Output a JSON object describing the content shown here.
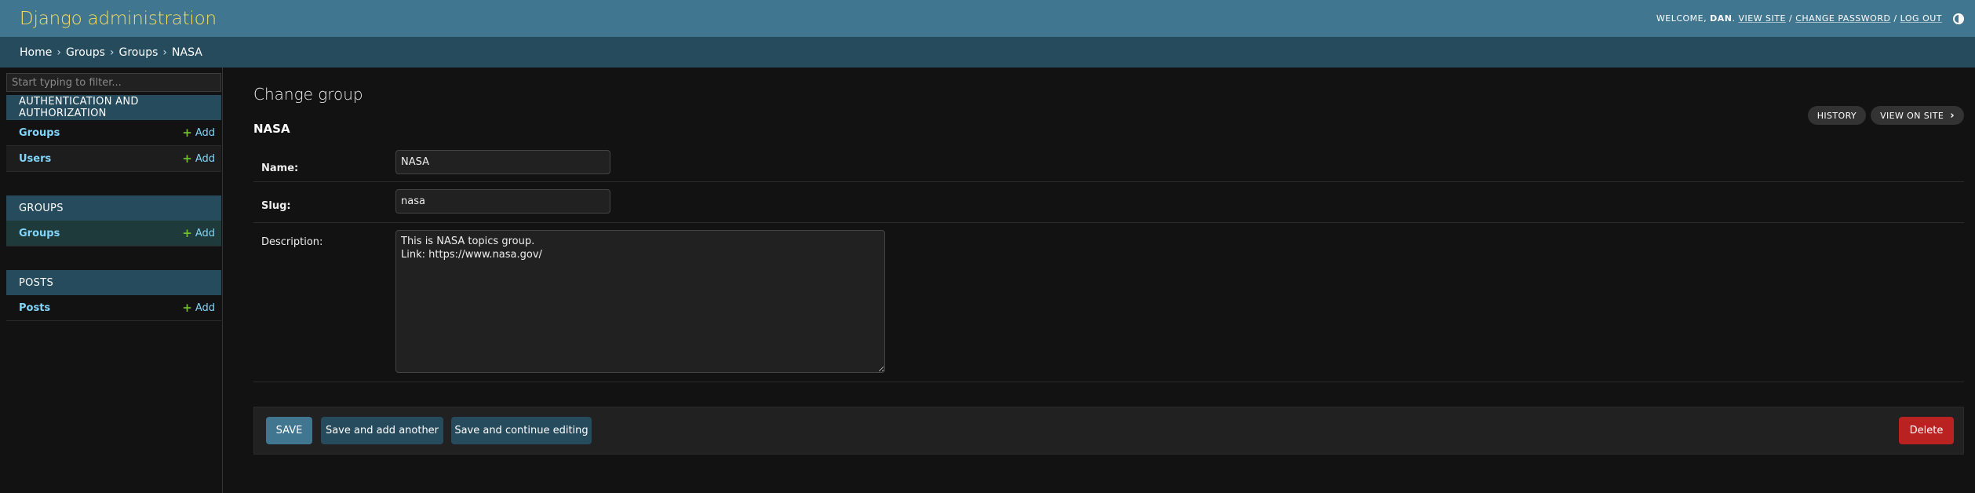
{
  "header": {
    "title": "Django administration",
    "welcome": "Welcome,",
    "username": "Dan",
    "view_site": "View site",
    "change_password": "Change password",
    "log_out": "Log out",
    "separator": "/"
  },
  "breadcrumbs": {
    "items": [
      "Home",
      "Groups",
      "Groups",
      "NASA"
    ],
    "separator": "›"
  },
  "sidebar": {
    "filter_placeholder": "Start typing to filter...",
    "modules": [
      {
        "caption": "Authentication and Authorization",
        "models": [
          {
            "name": "Groups",
            "add": "Add"
          },
          {
            "name": "Users",
            "add": "Add"
          }
        ]
      },
      {
        "caption": "Groups",
        "models": [
          {
            "name": "Groups",
            "add": "Add"
          }
        ]
      },
      {
        "caption": "Posts",
        "models": [
          {
            "name": "Posts",
            "add": "Add"
          }
        ]
      }
    ]
  },
  "main": {
    "page_title": "Change group",
    "object_name": "NASA",
    "object_tools": {
      "history": "History",
      "view_on_site": "View on site"
    },
    "fields": {
      "name": {
        "label": "Name:",
        "value": "NASA"
      },
      "slug": {
        "label": "Slug:",
        "value": "nasa"
      },
      "description": {
        "label": "Description:",
        "value": "This is NASA topics group.\nLink: https://www.nasa.gov/"
      }
    },
    "submit": {
      "save": "Save",
      "save_add_another": "Save and add another",
      "save_continue": "Save and continue editing",
      "delete": "Delete"
    }
  },
  "colors": {
    "header_bg": "#417690",
    "breadcrumb_bg": "#264b5d",
    "brand_text": "#f5dd5d",
    "link": "#81d4fa",
    "add_plus": "#70bf2b",
    "delete": "#ba2121"
  }
}
